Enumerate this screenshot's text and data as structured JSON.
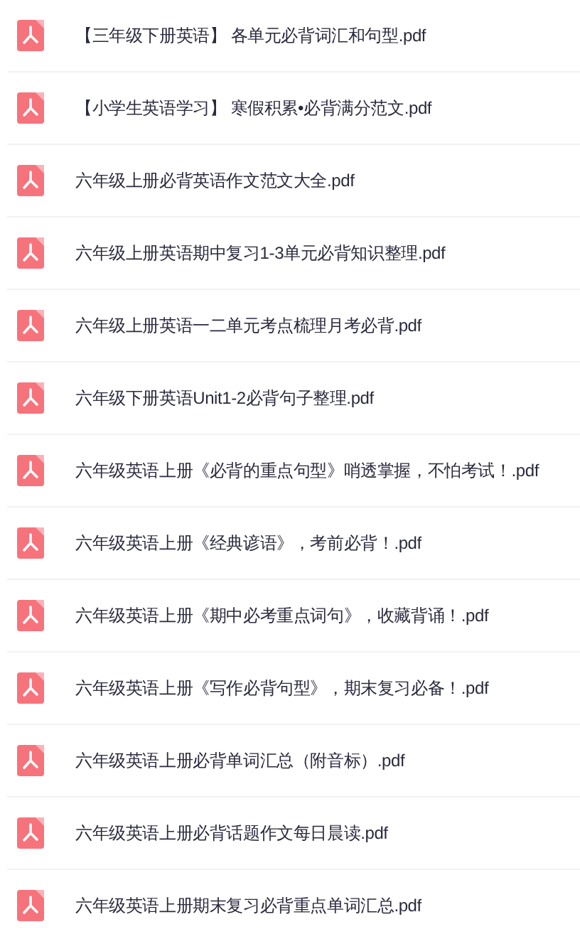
{
  "files": [
    {
      "name": "【三年级下册英语】 各单元必背词汇和句型.pdf"
    },
    {
      "name": "【小学生英语学习】 寒假积累•必背满分范文.pdf"
    },
    {
      "name": "六年级上册必背英语作文范文大全.pdf"
    },
    {
      "name": "六年级上册英语期中复习1-3单元必背知识整理.pdf"
    },
    {
      "name": "六年级上册英语一二单元考点梳理月考必背.pdf"
    },
    {
      "name": "六年级下册英语Unit1-2必背句子整理.pdf"
    },
    {
      "name": "六年级英语上册《必背的重点句型》哨透掌握，不怕考试！.pdf"
    },
    {
      "name": "六年级英语上册《经典谚语》，考前必背！.pdf"
    },
    {
      "name": "六年级英语上册《期中必考重点词句》，收藏背诵！.pdf"
    },
    {
      "name": "六年级英语上册《写作必背句型》，期末复习必备！.pdf"
    },
    {
      "name": "六年级英语上册必背单词汇总（附音标）.pdf"
    },
    {
      "name": "六年级英语上册必背话题作文每日晨读.pdf"
    },
    {
      "name": "六年级英语上册期末复习必背重点单词汇总.pdf"
    }
  ]
}
